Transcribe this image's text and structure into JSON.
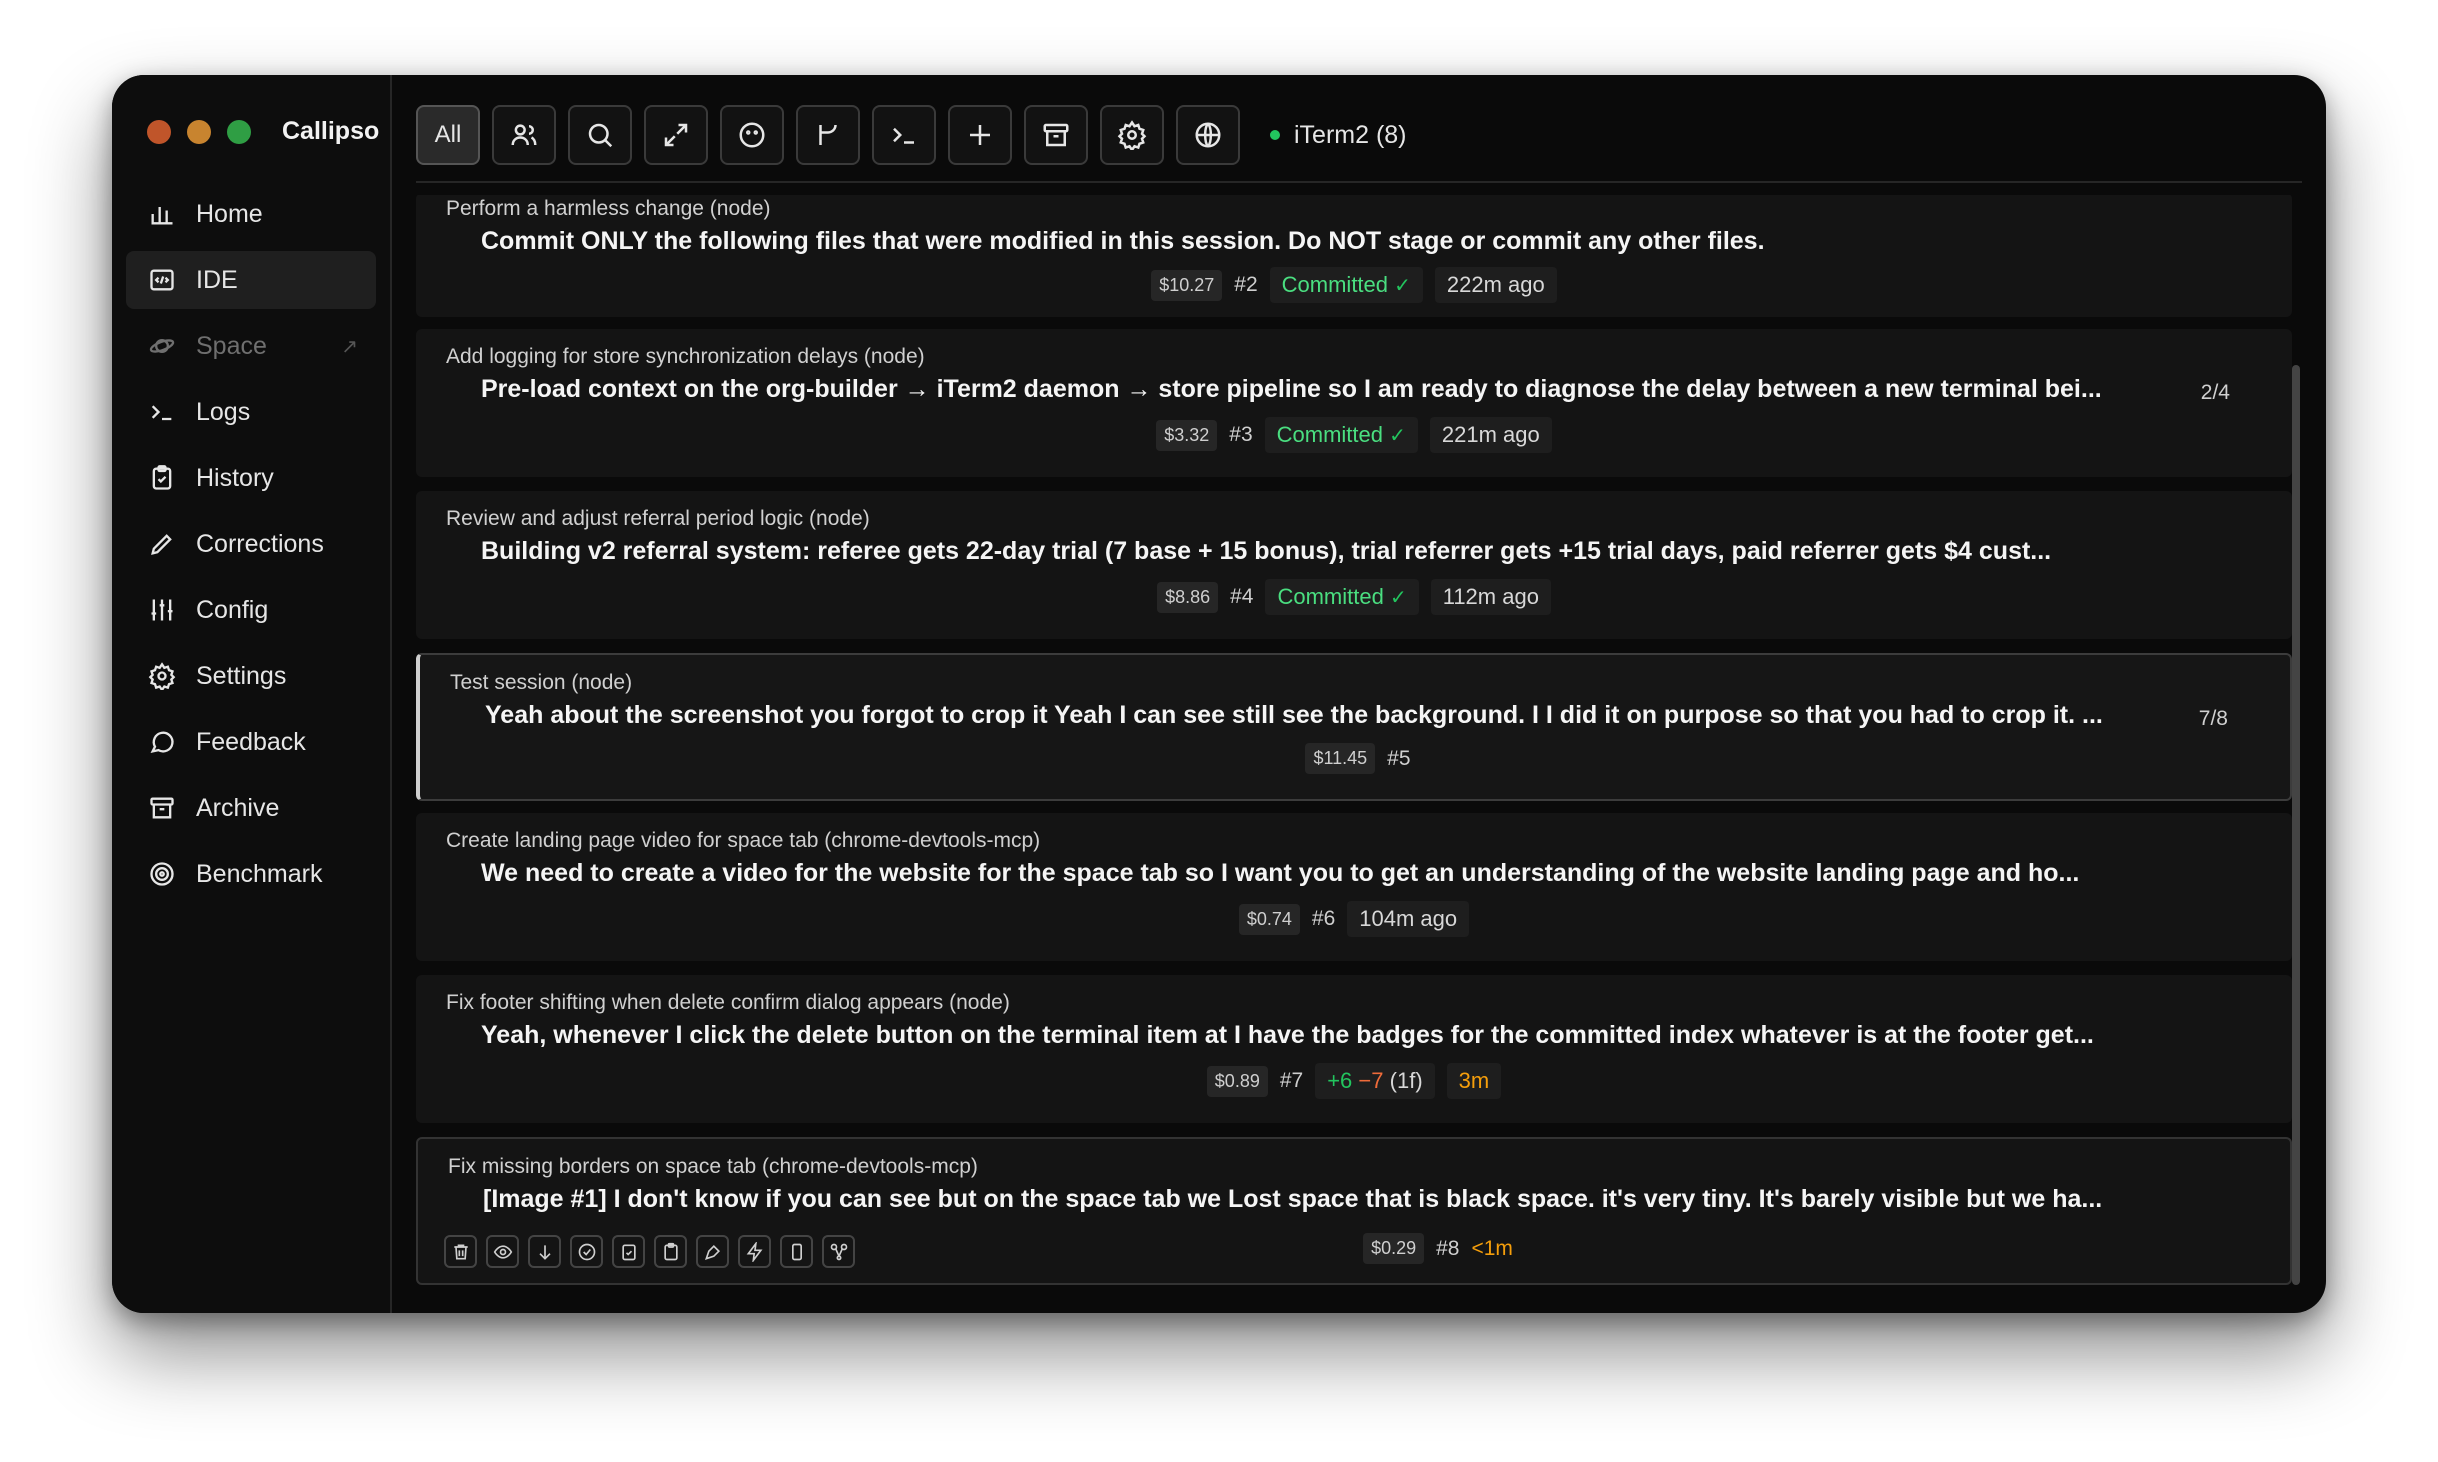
{
  "app": {
    "title": "Callipso"
  },
  "colors": {
    "close": "#c0552a",
    "minimize": "#c8842f",
    "zoom": "#2f9e44",
    "green": "#22c55e",
    "orange": "#f59e0b"
  },
  "sidebar": {
    "items": [
      {
        "label": "Home",
        "icon": "bar-chart-icon"
      },
      {
        "label": "IDE",
        "icon": "code-window-icon"
      },
      {
        "label": "Space",
        "icon": "planet-icon"
      },
      {
        "label": "Logs",
        "icon": "terminal-icon"
      },
      {
        "label": "History",
        "icon": "clipboard-icon"
      },
      {
        "label": "Corrections",
        "icon": "pencil-icon"
      },
      {
        "label": "Config",
        "icon": "sliders-icon"
      },
      {
        "label": "Settings",
        "icon": "gear-icon"
      },
      {
        "label": "Feedback",
        "icon": "chat-icon"
      },
      {
        "label": "Archive",
        "icon": "archive-icon"
      },
      {
        "label": "Benchmark",
        "icon": "target-icon"
      }
    ],
    "space_arrow": "↗"
  },
  "toolbar": {
    "all_label": "All",
    "icons": [
      "users-icon",
      "search-icon",
      "expand-icon",
      "smiley-icon",
      "branch-icon",
      "terminal-icon",
      "plus-icon",
      "archive-icon",
      "gear-icon",
      "globe-icon"
    ],
    "status": "iTerm2 (8)"
  },
  "sessions": [
    {
      "title": "Perform a harmless change (node)",
      "message": "Commit ONLY the following files that were modified in this session. Do NOT stage or commit any other files.",
      "cost": "$10.27",
      "num": "#2",
      "badge": "Committed",
      "check": "✓",
      "time": "222m ago"
    },
    {
      "title": "Add logging for store synchronization delays (node)",
      "message": "Pre-load context on the org-builder → iTerm2 daemon → store pipeline so I am ready to diagnose the delay between a new terminal bei...",
      "progress": "2/4",
      "cost": "$3.32",
      "num": "#3",
      "badge": "Committed",
      "check": "✓",
      "time": "221m ago"
    },
    {
      "title": "Review and adjust referral period logic (node)",
      "message": "Building v2 referral system: referee gets 22-day trial (7 base + 15 bonus), trial referrer gets +15 trial days, paid referrer gets $4 cust...",
      "cost": "$8.86",
      "num": "#4",
      "badge": "Committed",
      "check": "✓",
      "time": "112m ago"
    },
    {
      "title": "Test session (node)",
      "message": "Yeah about the screenshot you forgot to crop it Yeah I can see still see the background. I I did it on purpose so that you had to crop it. ...",
      "progress": "7/8",
      "cost": "$11.45",
      "num": "#5"
    },
    {
      "title": "Create landing page video for space tab (chrome-devtools-mcp)",
      "message": "We need to create a video for the website for the space tab so I want you to get an understanding of the website landing page and ho...",
      "cost": "$0.74",
      "num": "#6",
      "time": "104m ago"
    },
    {
      "title": "Fix footer shifting when delete confirm dialog appears (node)",
      "message": "Yeah, whenever I click the delete button on the terminal item at I have the badges for the committed index whatever is at the footer get...",
      "cost": "$0.89",
      "num": "#7",
      "added": "+6",
      "removed": "−7",
      "files": "(1f)",
      "time": "3m"
    },
    {
      "title": "Fix missing borders on space tab (chrome-devtools-mcp)",
      "message": "[Image #1] I don't know if you can see but on the space tab we Lost space that is black space. it's very tiny. It's barely visible but we ha...",
      "cost": "$0.29",
      "num": "#8",
      "time": "<1m",
      "actions": [
        "trash-icon",
        "eye-icon",
        "arrow-down-icon",
        "check-circle-icon",
        "clipboard-check-icon",
        "clipboard-icon",
        "pen-tool-icon",
        "lightning-icon",
        "phone-icon",
        "scissors-icon"
      ]
    }
  ]
}
